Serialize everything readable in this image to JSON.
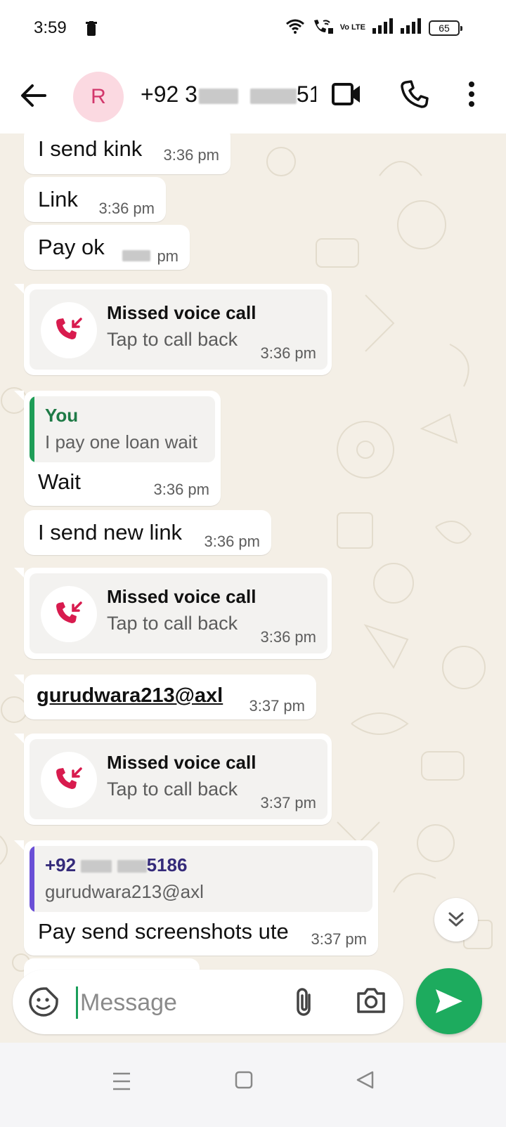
{
  "status_bar": {
    "time": "3:59",
    "battery": "65",
    "volte": "Vo LTE"
  },
  "header": {
    "avatar_letter": "R",
    "contact_prefix": "+92 3",
    "contact_suffix": "51..."
  },
  "messages": [
    {
      "text": "I send kink",
      "time": "3:36 pm"
    },
    {
      "text": "Link",
      "time": "3:36 pm"
    },
    {
      "text": "Pay ok",
      "time": "pm"
    },
    {
      "call_title": "Missed voice call",
      "call_sub": "Tap to call back",
      "time": "3:36 pm"
    },
    {
      "quote_name": "You",
      "quote_text": "I pay one loan wait",
      "text": "Wait",
      "time": "3:36 pm"
    },
    {
      "text": "I send new link",
      "time": "3:36 pm"
    },
    {
      "call_title": "Missed voice call",
      "call_sub": "Tap to call back",
      "time": "3:36 pm"
    },
    {
      "link": "gurudwara213@axl",
      "time": "3:37 pm"
    },
    {
      "call_title": "Missed voice call",
      "call_sub": "Tap to call back",
      "time": "3:37 pm"
    },
    {
      "quote_name_prefix": "+92",
      "quote_name_suffix": "5186",
      "quote_text": "gurudwara213@axl",
      "text": "Pay send screenshots ute",
      "time": "3:37 pm"
    }
  ],
  "composer": {
    "placeholder": "Message"
  },
  "colors": {
    "accent": "#1dab5e",
    "missed": "#d81b4e",
    "link": "#1565c0",
    "quote_you": "#1e9d57",
    "quote_other": "#6a4fd6"
  },
  "icons": [
    "trash-icon",
    "wifi-icon",
    "wifi-call-icon",
    "signal-icon",
    "battery-icon",
    "back-arrow-icon",
    "video-call-icon",
    "phone-icon",
    "more-vert-icon",
    "missed-call-icon",
    "scroll-down-icon",
    "sticker-icon",
    "attach-icon",
    "camera-icon",
    "send-icon",
    "recents-icon",
    "home-icon",
    "back-nav-icon"
  ]
}
